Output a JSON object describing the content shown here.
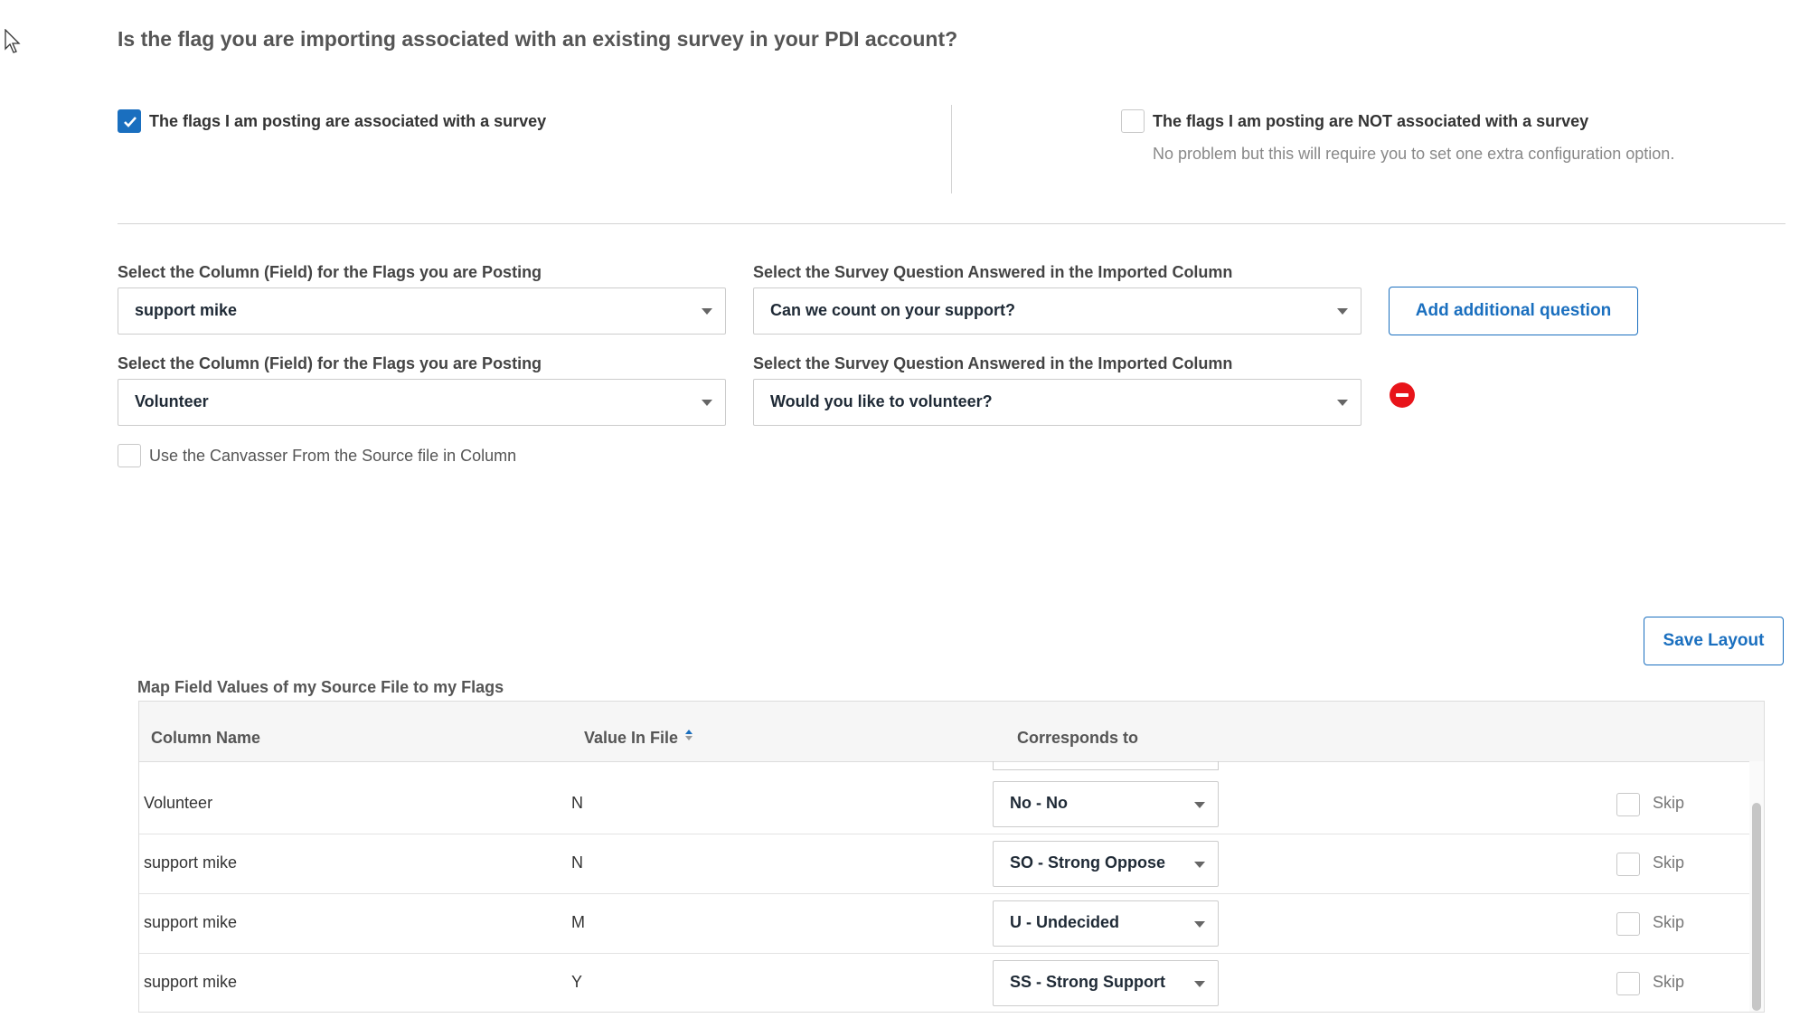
{
  "heading": "Is the flag you are importing associated with an existing survey in your PDI account?",
  "options": {
    "associated": {
      "label": "The flags I am posting are associated with a survey",
      "checked": true
    },
    "not_associated": {
      "label": "The flags I am posting are NOT associated with a survey",
      "note": "No problem but this will require you to set one extra configuration option.",
      "checked": false
    }
  },
  "mappings": [
    {
      "column_label": "Select the Column (Field) for the Flags you are Posting",
      "column_value": "support mike",
      "question_label": "Select the Survey Question Answered in the Imported Column",
      "question_value": "Can we count on your support?"
    },
    {
      "column_label": "Select the Column (Field) for the Flags you are Posting",
      "column_value": "Volunteer",
      "question_label": "Select the Survey Question Answered in the Imported Column",
      "question_value": "Would you like to volunteer?"
    }
  ],
  "add_question_button": "Add additional question",
  "canvasser_option": "Use the Canvasser From the Source file in Column",
  "save_layout_button": "Save Layout",
  "table": {
    "title": "Map Field Values of my Source File to my Flags",
    "headers": [
      "Column Name",
      "Value In File",
      "Corresponds to"
    ],
    "skip_label": "Skip",
    "rows": [
      {
        "column": "Volunteer",
        "value": "N",
        "corresponds": "No - No"
      },
      {
        "column": "support mike",
        "value": "N",
        "corresponds": "SO - Strong Oppose"
      },
      {
        "column": "support mike",
        "value": "M",
        "corresponds": "U - Undecided"
      },
      {
        "column": "support mike",
        "value": "Y",
        "corresponds": "SS - Strong Support"
      }
    ]
  },
  "colors": {
    "accent": "#1a6fbf",
    "remove": "#e8141a"
  }
}
